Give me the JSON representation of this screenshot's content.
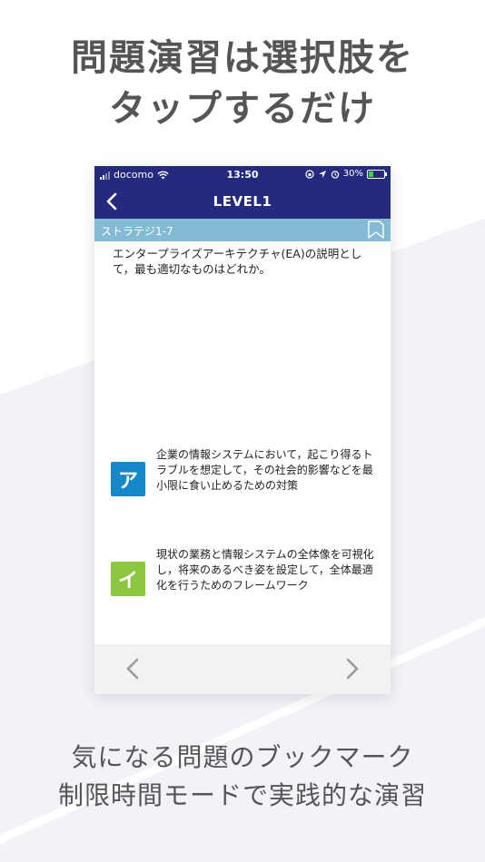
{
  "headline": {
    "line1": "問題演習は選択肢を",
    "line2": "タップするだけ"
  },
  "status_bar": {
    "carrier": "docomo",
    "time": "13:50",
    "battery": "30%",
    "icons": [
      "signal-icon",
      "wifi-icon",
      "lock-rotation-icon",
      "location-icon",
      "alarm-icon",
      "battery-icon"
    ]
  },
  "nav": {
    "title": "LEVEL1",
    "back_icon": "chevron-left-icon"
  },
  "category": {
    "label": "ストラテジ1-7",
    "bookmark_icon": "bookmark-icon"
  },
  "question": {
    "text": "エンタープライズアーキテクチャ(EA)の説明として，最も適切なものはどれか。"
  },
  "choices": [
    {
      "badge": "ア",
      "text": "企業の情報システムにおいて，起こり得るトラブルを想定して，その社会的影響などを最小限に食い止めるための対策",
      "color": "#1688c8"
    },
    {
      "badge": "イ",
      "text": "現状の業務と情報システムの全体像を可視化し，将来のあるべき姿を設定して，全体最適化を行うためのフレームワーク",
      "color": "#8dc63f"
    }
  ],
  "bottom_nav": {
    "prev_icon": "chevron-left-icon",
    "next_icon": "chevron-right-icon"
  },
  "footer": {
    "line1": "気になる問題のブックマーク",
    "line2": "制限時間モードで実践的な演習"
  },
  "colors": {
    "nav_bg": "#262a7e",
    "category_bg": "#83bbd4",
    "text_heading": "#555555"
  }
}
